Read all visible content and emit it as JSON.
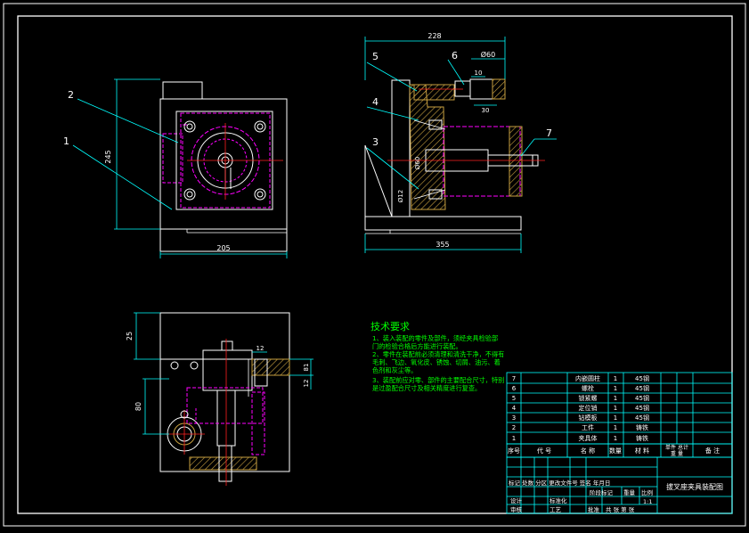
{
  "colors": {
    "background": "#000000",
    "outline": "#ffffff",
    "dimension": "#00ffff",
    "hidden": "#ff00ff",
    "center": "#ff2020",
    "section": "#c8a040",
    "text": "#00ff00",
    "hatch": "#c8a040"
  },
  "front_view": {
    "part_labels": [
      "2",
      "1"
    ],
    "dim_height": "245",
    "dim_width": "205"
  },
  "side_view": {
    "part_labels": [
      "5",
      "6",
      "4",
      "3",
      "7"
    ],
    "dim_overall": "228",
    "dim_bottom": "355",
    "dim_dia": "Ø60",
    "dim_small": "10",
    "dim_mid": "30",
    "dim_bore": "Ø60",
    "dim_bore2": "Ø12"
  },
  "top_view": {
    "dim_left": "25",
    "dim_mid": "80",
    "dim_right1": "12",
    "dim_right2": "81",
    "dim_right3": "12"
  },
  "tech_notes": {
    "heading": "技术要求",
    "lines": [
      "1、装入装配的零件及部件，须经夹具检验部",
      "门的检验合格后方能进行装配。",
      "2、零件在装配前必须清理和清洗干净，不得有",
      "毛刺、飞边、氧化皮、锈蚀、切屑、油污、着",
      "色剂和灰尘等。",
      "3、装配前应对零、部件的主要配合尺寸，特别",
      "是过盈配合尺寸及相关精度进行复查。"
    ]
  },
  "parts_list": {
    "rows": [
      {
        "no": "7",
        "code": "",
        "name": "内嵌圆柱",
        "qty": "1",
        "material": "45钢"
      },
      {
        "no": "6",
        "code": "",
        "name": "螺栓",
        "qty": "1",
        "material": "45钢"
      },
      {
        "no": "5",
        "code": "",
        "name": "锁紧螺",
        "qty": "1",
        "material": "45钢"
      },
      {
        "no": "4",
        "code": "",
        "name": "定位销",
        "qty": "1",
        "material": "45钢"
      },
      {
        "no": "3",
        "code": "",
        "name": "钻模板",
        "qty": "1",
        "material": "45钢"
      },
      {
        "no": "2",
        "code": "",
        "name": "工件",
        "qty": "1",
        "material": "铸铁"
      },
      {
        "no": "1",
        "code": "",
        "name": "夹具体",
        "qty": "1",
        "material": "铸铁"
      }
    ],
    "header": {
      "no": "序号",
      "code": "代  号",
      "name": "名  称",
      "qty": "数量",
      "material": "材  料",
      "unit_weight": "单件 总计",
      "total_weight": "重  量",
      "note": "备  注"
    }
  },
  "title_block": {
    "drawing_title": "拔叉座夹具装配图",
    "scale": "1:1",
    "labels": {
      "row_a": "标记 处数 分区 更改文件号 签名 年月日",
      "design": "设计",
      "std": "标准化",
      "stage": "阶段标记",
      "weight": "重量",
      "ratio": "比例",
      "review": "审核",
      "process": "工艺",
      "approve": "批准",
      "sheet": "共  张  第  张"
    }
  }
}
